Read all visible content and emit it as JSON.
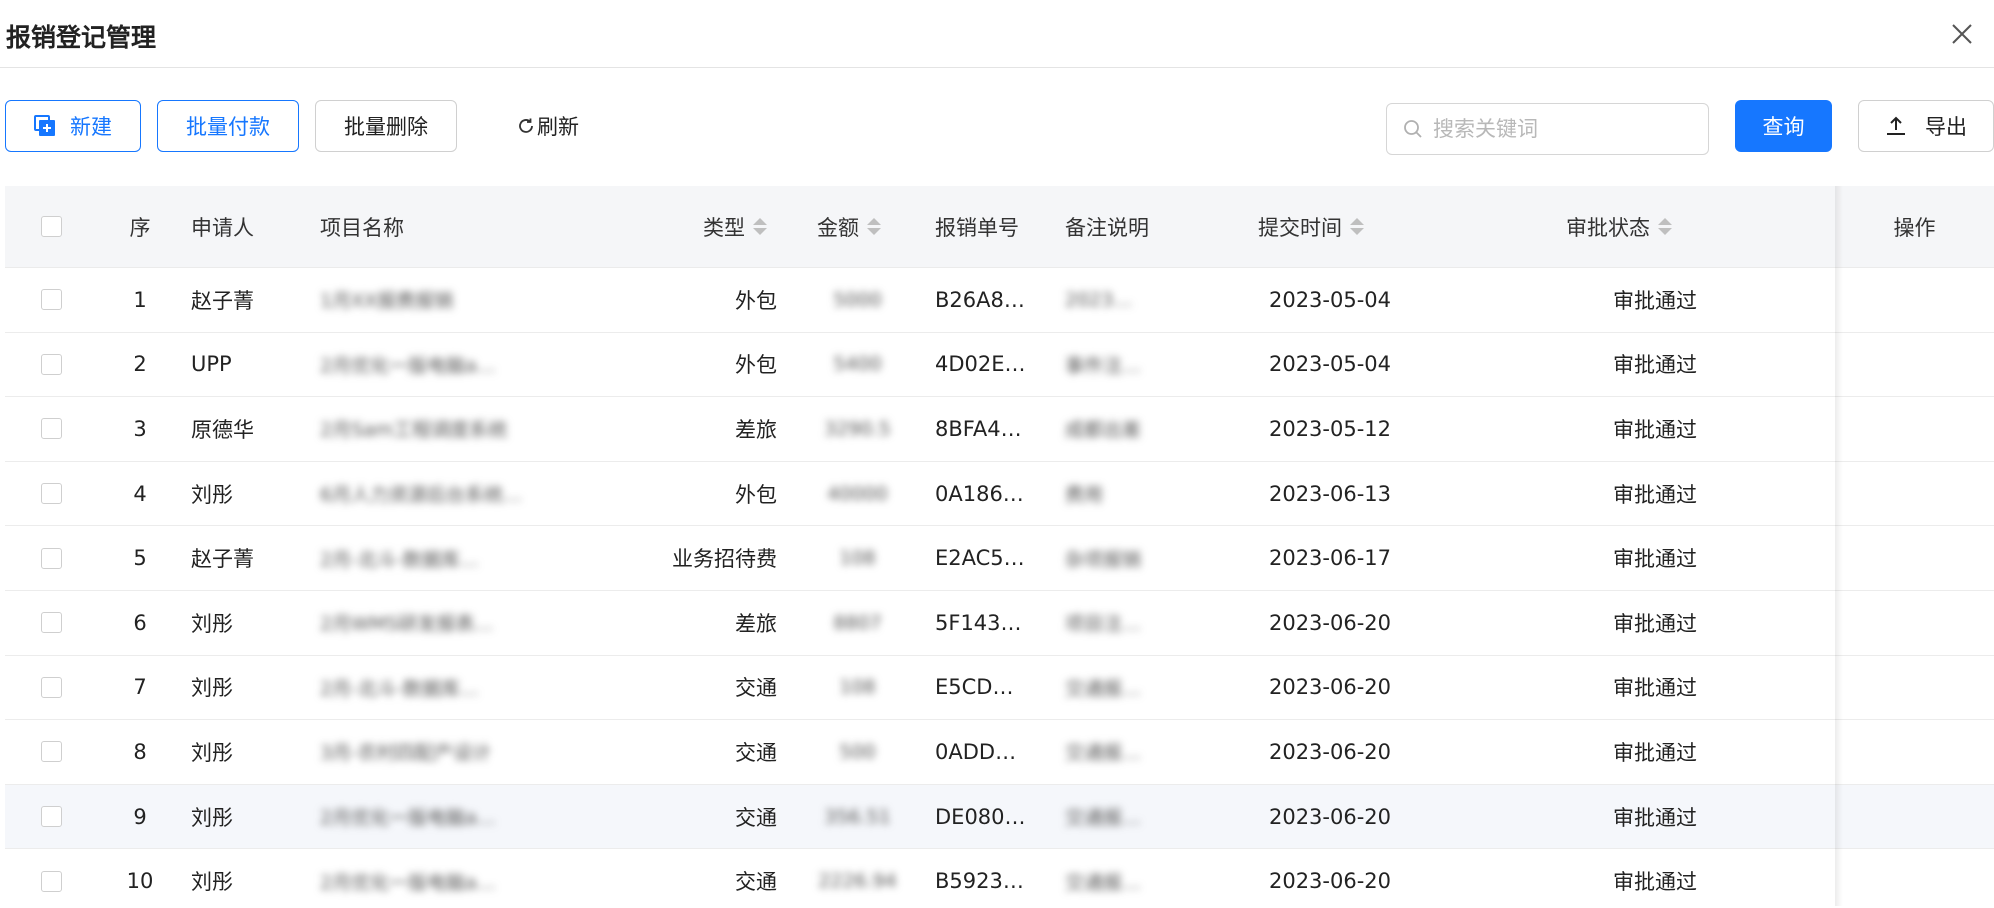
{
  "header": {
    "title": "报销登记管理"
  },
  "toolbar": {
    "new_label": "新建",
    "batch_pay_label": "批量付款",
    "batch_delete_label": "批量删除",
    "refresh_label": "刷新",
    "search_placeholder": "搜索关键词",
    "query_label": "查询",
    "export_label": "导出"
  },
  "table": {
    "columns": {
      "index": "序",
      "applicant": "申请人",
      "project": "项目名称",
      "type": "类型",
      "amount": "金额",
      "number": "报销单号",
      "note": "备注说明",
      "submit_time": "提交时间",
      "status": "审批状态",
      "operation": "操作"
    },
    "rows": [
      {
        "index": "1",
        "applicant": "赵子菁",
        "project": "1月XX报费报销",
        "type": "外包",
        "amount": "5000",
        "number": "B26A8…",
        "note": "2023…",
        "submit_time": "2023-05-04",
        "status": "审批通过"
      },
      {
        "index": "2",
        "applicant": "UPP",
        "project": "2月优化一版电脑a…",
        "type": "外包",
        "amount": "5400",
        "number": "4D02E…",
        "note": "事件注…",
        "submit_time": "2023-05-04",
        "status": "审批通过"
      },
      {
        "index": "3",
        "applicant": "原德华",
        "project": "2月Sam工程调度系统",
        "type": "差旅",
        "amount": "3290.5",
        "number": "8BFA4…",
        "note": "成都出差",
        "submit_time": "2023-05-12",
        "status": "审批通过"
      },
      {
        "index": "4",
        "applicant": "刘彤",
        "project": "6月人力资源后台系统…",
        "type": "外包",
        "amount": "40000",
        "number": "0A186…",
        "note": "费用",
        "submit_time": "2023-06-13",
        "status": "审批通过"
      },
      {
        "index": "5",
        "applicant": "赵子菁",
        "project": "2月-北斗-数据库…",
        "type": "业务招待费",
        "amount": "108",
        "number": "E2AC5…",
        "note": "杂项报销",
        "submit_time": "2023-06-17",
        "status": "审批通过"
      },
      {
        "index": "6",
        "applicant": "刘彤",
        "project": "2月WMS研发报表…",
        "type": "差旅",
        "amount": "8807",
        "number": "5F143…",
        "note": "项目注…",
        "submit_time": "2023-06-20",
        "status": "审批通过"
      },
      {
        "index": "7",
        "applicant": "刘彤",
        "project": "2月-北斗-数据库…",
        "type": "交通",
        "amount": "108",
        "number": "E5CD…",
        "note": "交通报…",
        "submit_time": "2023-06-20",
        "status": "审批通过"
      },
      {
        "index": "8",
        "applicant": "刘彤",
        "project": "3月-农村四配产设计",
        "type": "交通",
        "amount": "500",
        "number": "0ADD…",
        "note": "交通报…",
        "submit_time": "2023-06-20",
        "status": "审批通过"
      },
      {
        "index": "9",
        "applicant": "刘彤",
        "project": "2月优化一版电脑a…",
        "type": "交通",
        "amount": "356.51",
        "number": "DE080…",
        "note": "交通报…",
        "submit_time": "2023-06-20",
        "status": "审批通过"
      },
      {
        "index": "10",
        "applicant": "刘彤",
        "project": "2月优化一版电脑a…",
        "type": "交通",
        "amount": "2226.94",
        "number": "B5923…",
        "note": "交通报…",
        "submit_time": "2023-06-20",
        "status": "审批通过"
      }
    ]
  },
  "colors": {
    "primary": "#1677ff",
    "header_bg": "#f5f6f8",
    "highlight_row": "#f5f7fb"
  },
  "icons": {
    "new": "add-document-icon",
    "refresh": "refresh-icon",
    "search": "search-icon",
    "export": "upload-icon",
    "close": "close-icon",
    "sort": "sort-icon"
  }
}
